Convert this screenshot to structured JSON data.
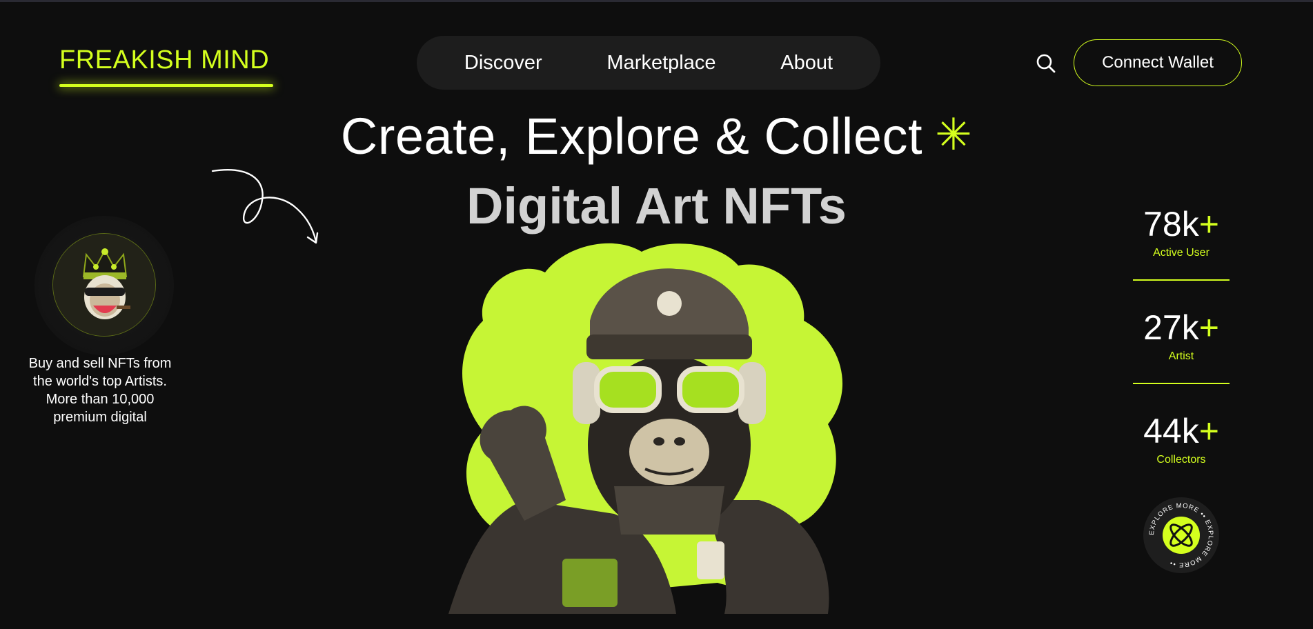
{
  "brand": {
    "logo": "FREAKISH MIND",
    "accent_color": "#d4ff1e",
    "background": "#0e0e0e"
  },
  "nav": {
    "items": [
      {
        "label": "Discover"
      },
      {
        "label": "Marketplace"
      },
      {
        "label": "About"
      }
    ]
  },
  "header": {
    "search_icon": "search-icon",
    "wallet_button": "Connect Wallet"
  },
  "hero": {
    "headline": "Create, Explore & Collect",
    "headline_mark": "✳",
    "subheadline": "Digital Art NFTs",
    "description": "Buy and sell NFTs from the world's top Artists. More than 10,000 premium digital"
  },
  "stats": [
    {
      "value": "78k",
      "suffix": "+",
      "label": "Active User"
    },
    {
      "value": "27k",
      "suffix": "+",
      "label": "Artist"
    },
    {
      "value": "44k",
      "suffix": "+",
      "label": "Collectors"
    }
  ],
  "explore_badge": {
    "text": "EXPLORE MORE •• EXPLORE MORE ••"
  }
}
